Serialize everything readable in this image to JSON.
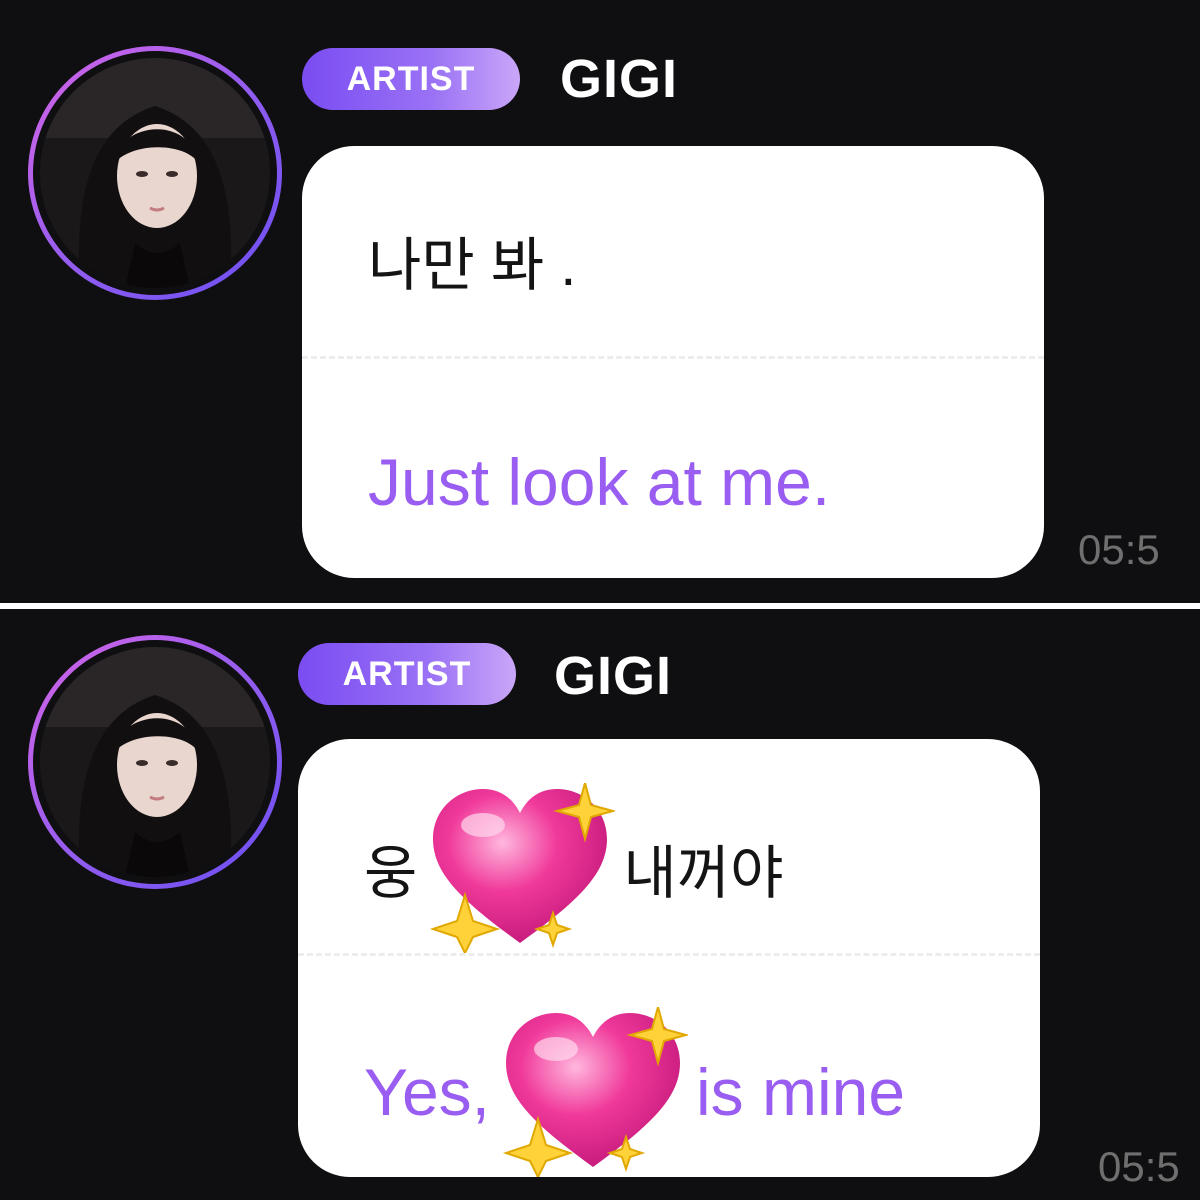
{
  "messages": [
    {
      "badge": "ARTIST",
      "sender": "GIGI",
      "original_parts": [
        "나만 봐 ."
      ],
      "translation_parts": [
        "Just look at me."
      ],
      "time": "05:5"
    },
    {
      "badge": "ARTIST",
      "sender": "GIGI",
      "original_before": "웅",
      "original_after": "내꺼야",
      "translation_before": "Yes,",
      "translation_after": "is mine",
      "emoji": "sparkling-heart-icon",
      "time": "05:5"
    }
  ],
  "colors": {
    "background": "#0f0e10",
    "badge_start": "#7a4cf2",
    "badge_end": "#caa6f8",
    "translation_text": "#9a5df2",
    "time_text": "#6f6f6f",
    "heart_pink": "#f0399a",
    "sparkle_yellow": "#ffd23a"
  }
}
